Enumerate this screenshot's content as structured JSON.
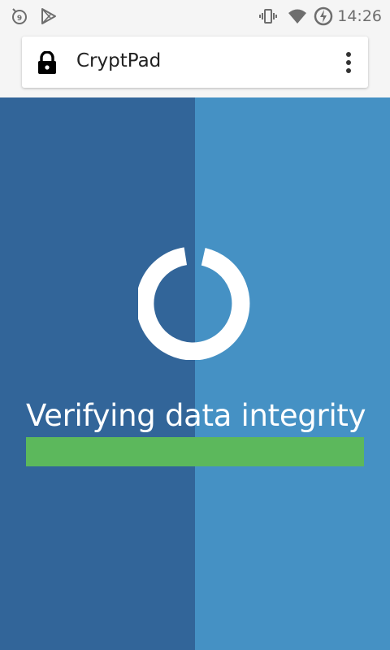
{
  "status_bar": {
    "time": "14:26",
    "icons": [
      "notification-9-icon",
      "play-store-icon",
      "vibrate-icon",
      "wifi-icon",
      "battery-charging-icon"
    ]
  },
  "browser": {
    "url": "CryptPad",
    "secure_icon": "lock-icon",
    "menu_icon": "overflow-menu-icon"
  },
  "loading": {
    "message": "Verifying data integrity",
    "progress_percent": 100,
    "spinner_icon": "loading-spinner-icon"
  },
  "colors": {
    "panel_left": "#326599",
    "panel_right": "#4591c4",
    "progress": "#5cb85c"
  }
}
